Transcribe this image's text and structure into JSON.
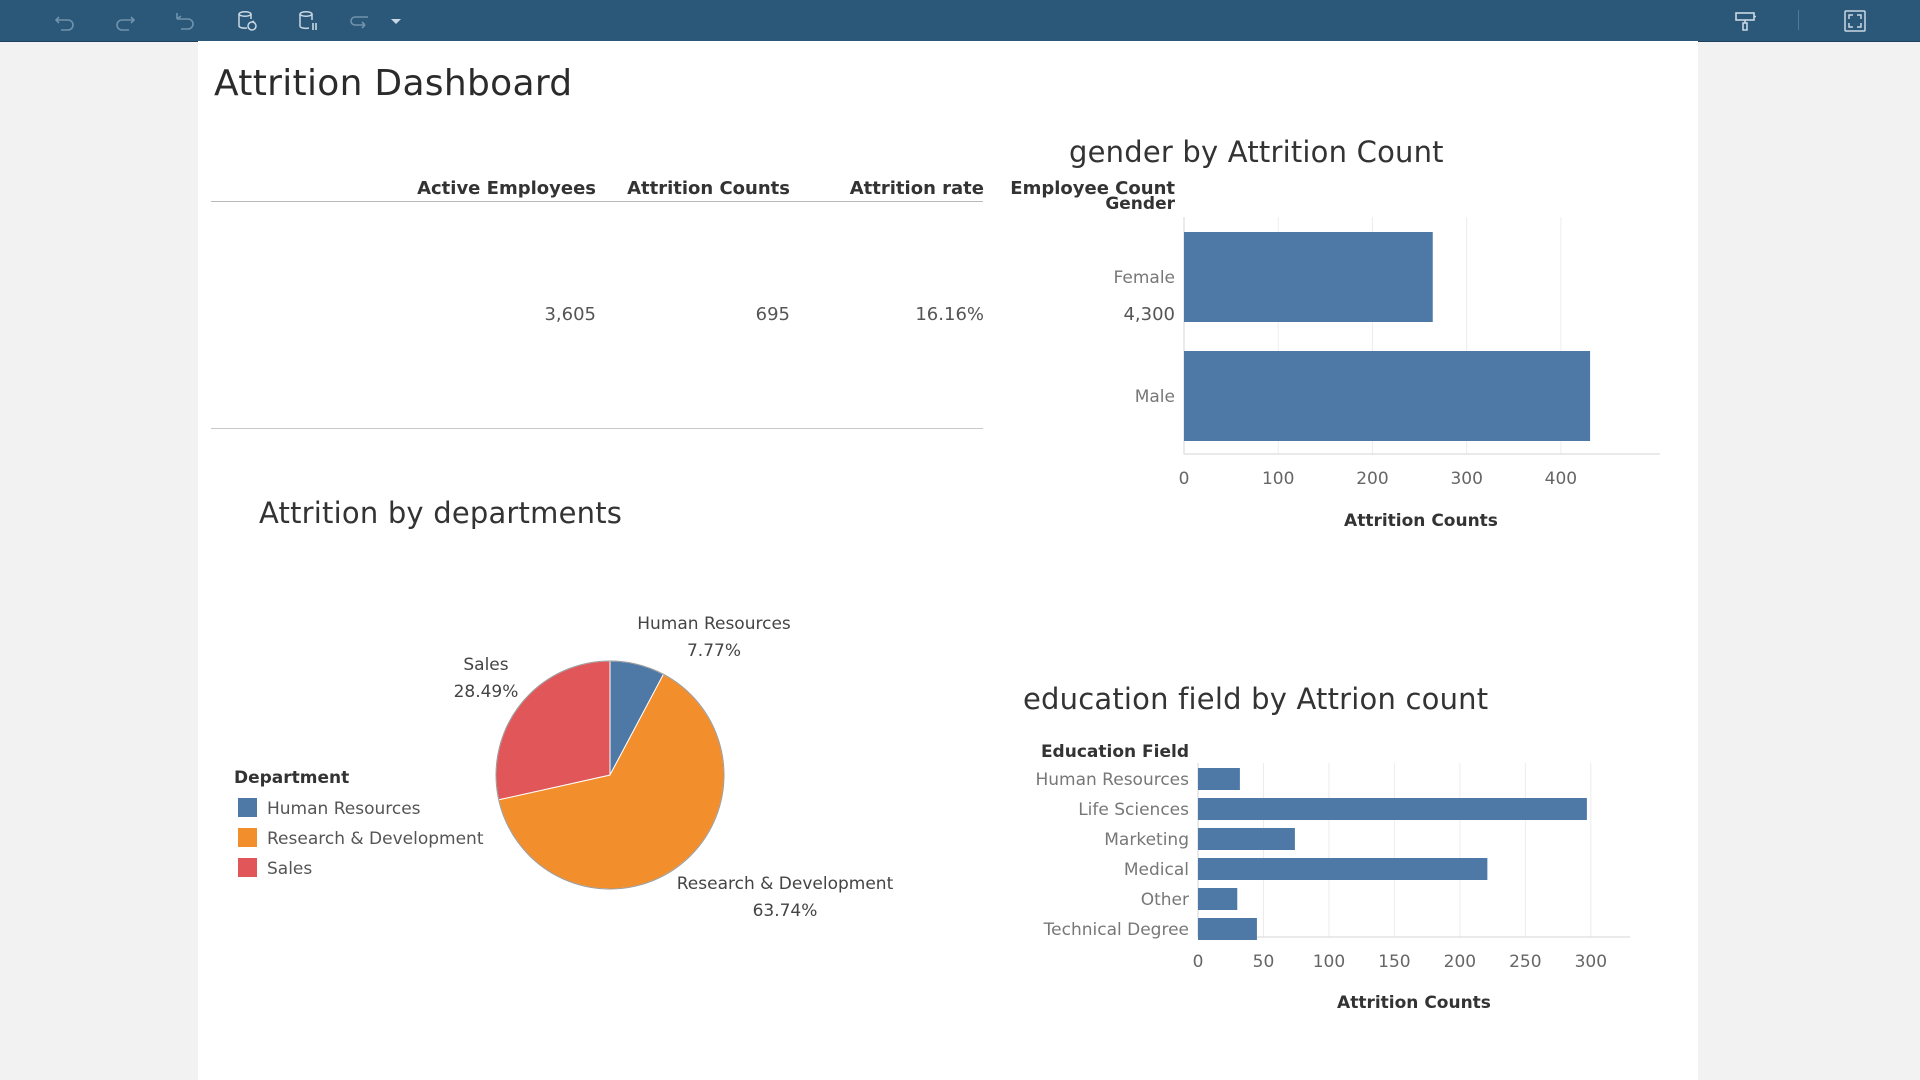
{
  "toolbar": {
    "left_icons": [
      "undo-icon",
      "redo-icon",
      "revert-icon",
      "refresh-data-icon",
      "pause-updates-icon",
      "replay-icon",
      "dropdown-caret-icon"
    ],
    "right_icons": [
      "presentation-mode-icon",
      "full-screen-icon"
    ],
    "colors": {
      "background": "#2b5778",
      "icon": "#c9d8e4",
      "icon_disabled": "#6f93ad"
    }
  },
  "dashboard": {
    "title": "Attrition Dashboard"
  },
  "kpis": {
    "headers": [
      "Active Employees",
      "Attrition Counts",
      "Attrition rate",
      "Employee Count"
    ],
    "values": [
      "3,605",
      "695",
      "16.16%",
      "4,300"
    ]
  },
  "chart_data": [
    {
      "type": "bar",
      "orientation": "horizontal",
      "title": "gender by Attrition Count",
      "row_header": "Gender",
      "categories": [
        "Female",
        "Male"
      ],
      "values": [
        264,
        431
      ],
      "xlabel": "Attrition Counts",
      "xlim": [
        0,
        450
      ],
      "xticks": [
        0,
        100,
        200,
        300,
        400
      ],
      "grid": true,
      "color": "#4e79a7"
    },
    {
      "type": "pie",
      "title": "Attrition by departments",
      "legend_title": "Department",
      "legend_position": "left",
      "slices": [
        {
          "label": "Human Resources",
          "percent_label": "7.77%",
          "value": 7.77,
          "color": "#4e79a7"
        },
        {
          "label": "Research & Development",
          "percent_label": "63.74%",
          "value": 63.74,
          "color": "#f28e2b"
        },
        {
          "label": "Sales",
          "percent_label": "28.49%",
          "value": 28.49,
          "color": "#e15759"
        }
      ]
    },
    {
      "type": "bar",
      "orientation": "horizontal",
      "title": "education field by Attrion count",
      "row_header": "Education Field",
      "categories": [
        "Human Resources",
        "Life Sciences",
        "Marketing",
        "Medical",
        "Other",
        "Technical Degree"
      ],
      "values": [
        32,
        297,
        74,
        221,
        30,
        45
      ],
      "xlabel": "Attrition Counts",
      "xlim": [
        0,
        320
      ],
      "xticks": [
        0,
        50,
        100,
        150,
        200,
        250,
        300
      ],
      "grid": true,
      "color": "#4e79a7"
    }
  ]
}
